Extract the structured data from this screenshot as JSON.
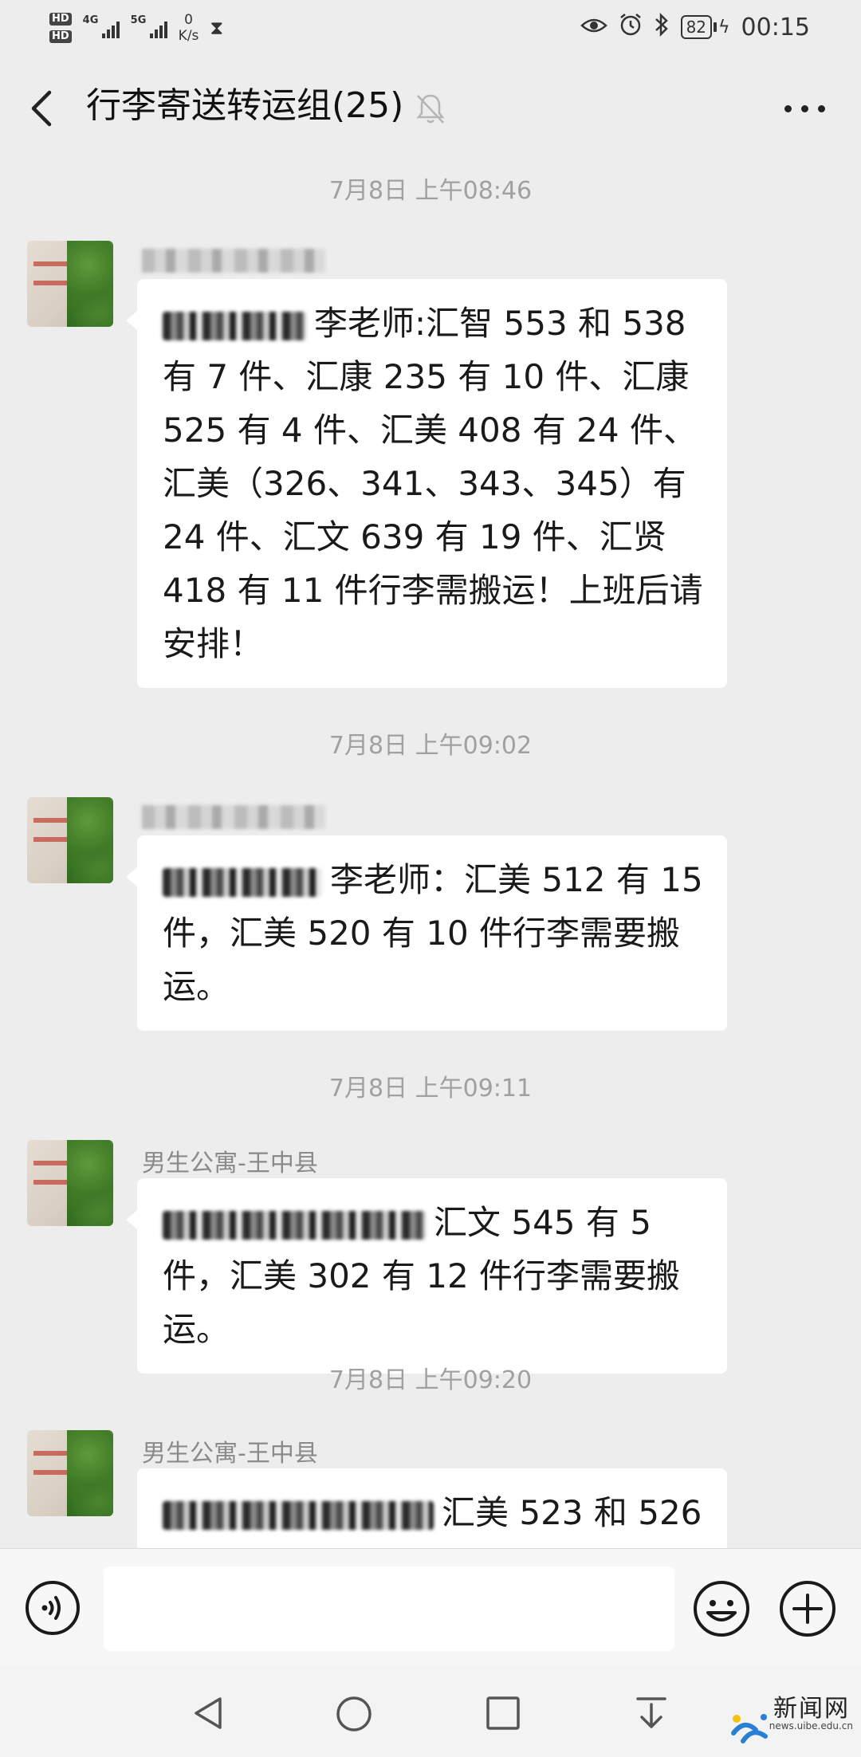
{
  "status_bar": {
    "hd1": "HD",
    "hd2": "HD",
    "net1": "4G",
    "net2": "5G",
    "speed_value": "0",
    "speed_unit": "K/s",
    "battery": "82",
    "time": "00:15"
  },
  "header": {
    "title": "行李寄送转运组(25)"
  },
  "messages": [
    {
      "time": "7月8日 上午08:46",
      "sender": "",
      "text": "李老师:汇智 553 和 538 有 7 件、汇康 235 有 10 件、汇康 525 有 4 件、汇美 408 有 24 件、汇美（326、341、343、345）有 24 件、汇文 639 有 19 件、汇贤 418 有 11 件行李需搬运！上班后请安排！"
    },
    {
      "time": "7月8日 上午09:02",
      "sender": "",
      "text": "李老师：汇美 512 有 15 件，汇美 520 有 10 件行李需要搬运。"
    },
    {
      "time": "7月8日 上午09:11",
      "sender": "男生公寓-王中县",
      "text": "汇文 545 有 5 件，汇美 302 有 12 件行李需要搬运。"
    },
    {
      "time": "7月8日 上午09:20",
      "sender": "男生公寓-王中县",
      "text": "汇美 523 和 526"
    }
  ],
  "input": {
    "placeholder": ""
  },
  "watermark": {
    "title": "新闻网",
    "url": "news.uibe.edu.cn"
  }
}
